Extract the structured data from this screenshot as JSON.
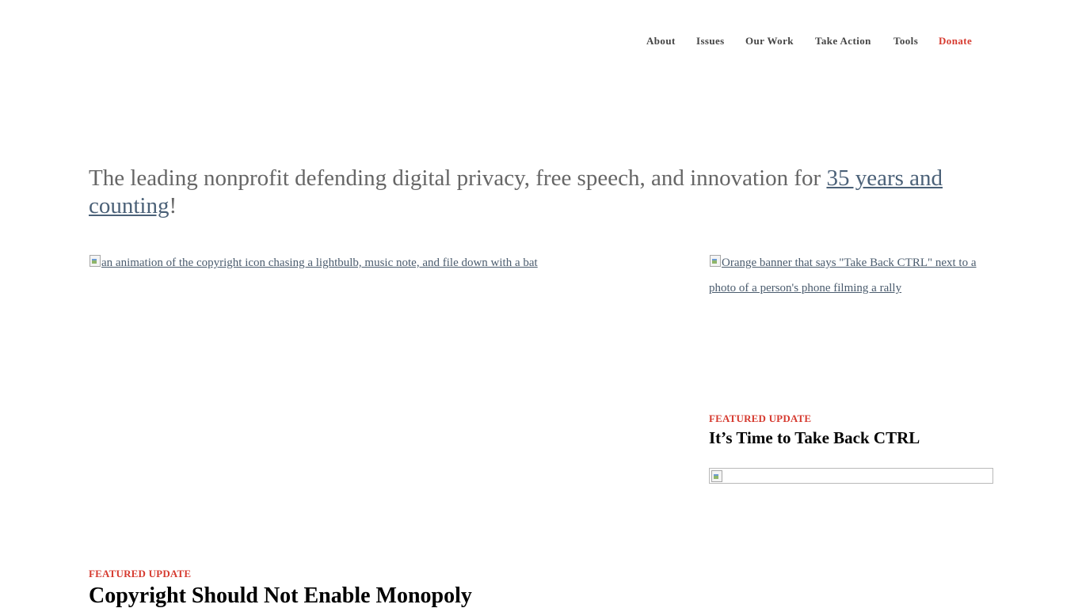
{
  "nav": {
    "items": [
      {
        "label": "About"
      },
      {
        "label": "Issues"
      },
      {
        "label": "Our Work"
      },
      {
        "label": "Take Action"
      },
      {
        "label": "Tools"
      },
      {
        "label": "Donate"
      }
    ],
    "donate_color": "#d63a2f"
  },
  "tagline": {
    "text_before": "The leading nonprofit defending digital privacy, free speech, and innovation for ",
    "link_text": "35 years and counting",
    "text_after": "!"
  },
  "hero": {
    "image_alt": "an animation of the copyright icon chasing a lightbulb, music note, and file down with a bat",
    "eyebrow": "FEATURED UPDATE",
    "title": "Copyright Should Not Enable Monopoly"
  },
  "sidebar": {
    "image_alt": "Orange banner that says \"Take Back CTRL\" next to a photo of a person's phone filming a rally",
    "eyebrow": "FEATURED UPDATE",
    "title": "It’s Time to Take Back CTRL"
  },
  "colors": {
    "accent_red": "#d63a2f",
    "link": "#4b5c6e",
    "tagline": "#666666"
  }
}
